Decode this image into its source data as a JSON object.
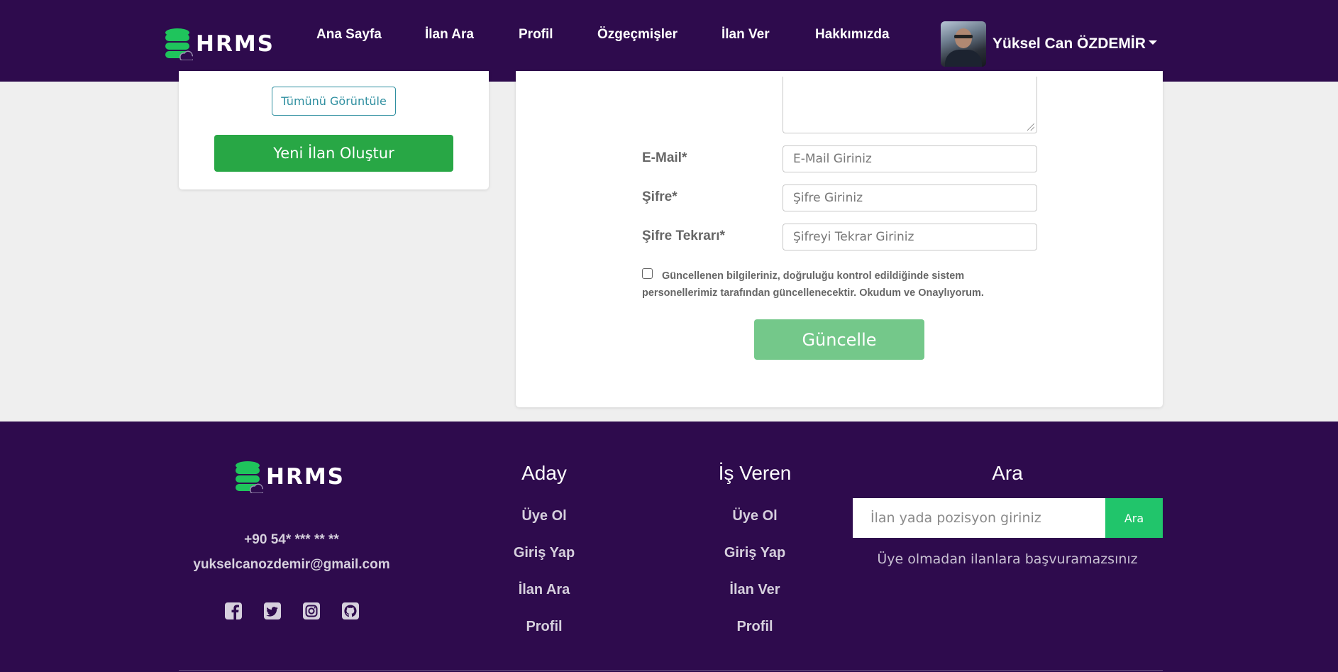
{
  "header": {
    "logo_text": "HRMS",
    "nav": [
      "Ana Sayfa",
      "İlan Ara",
      "Profil",
      "Özgeçmişler",
      "İlan Ver",
      "Hakkımızda"
    ],
    "user_name": "Yüksel Can ÖZDEMİR"
  },
  "sidebar_card": {
    "view_all_label": "Tümünü Görüntüle",
    "new_ad_label": "Yeni İlan Oluştur"
  },
  "form": {
    "email_label": "E-Mail*",
    "email_placeholder": "E-Mail Giriniz",
    "password_label": "Şifre*",
    "password_placeholder": "Şifre Giriniz",
    "password_repeat_label": "Şifre Tekrarı*",
    "password_repeat_placeholder": "Şifreyi Tekrar Giriniz",
    "consent_text": "Güncellenen bilgileriniz, doğruluğu kontrol edildiğinde sistem personellerimiz tarafından güncellenecektir. Okudum ve Onaylıyorum.",
    "submit_label": "Güncelle"
  },
  "footer": {
    "logo_text": "HRMS",
    "phone": "+90 54* *** ** **",
    "email": "yukselcanozdemir@gmail.com",
    "social_icons": [
      "facebook-icon",
      "twitter-icon",
      "instagram-icon",
      "github-icon"
    ],
    "candidate": {
      "heading": "Aday",
      "links": [
        "Üye Ol",
        "Giriş Yap",
        "İlan Ara",
        "Profil"
      ]
    },
    "employer": {
      "heading": "İş Veren",
      "links": [
        "Üye Ol",
        "Giriş Yap",
        "İlan Ver",
        "Profil"
      ]
    },
    "search": {
      "heading": "Ara",
      "placeholder": "İlan yada pozisyon giriniz",
      "button_label": "Ara",
      "note": "Üye olmadan ilanlara başvuramazsınız"
    }
  },
  "colors": {
    "brand_purple": "#2e0b4d",
    "accent_green": "#28a745",
    "search_green": "#21c56b",
    "logo_green": "#1fc45c"
  }
}
